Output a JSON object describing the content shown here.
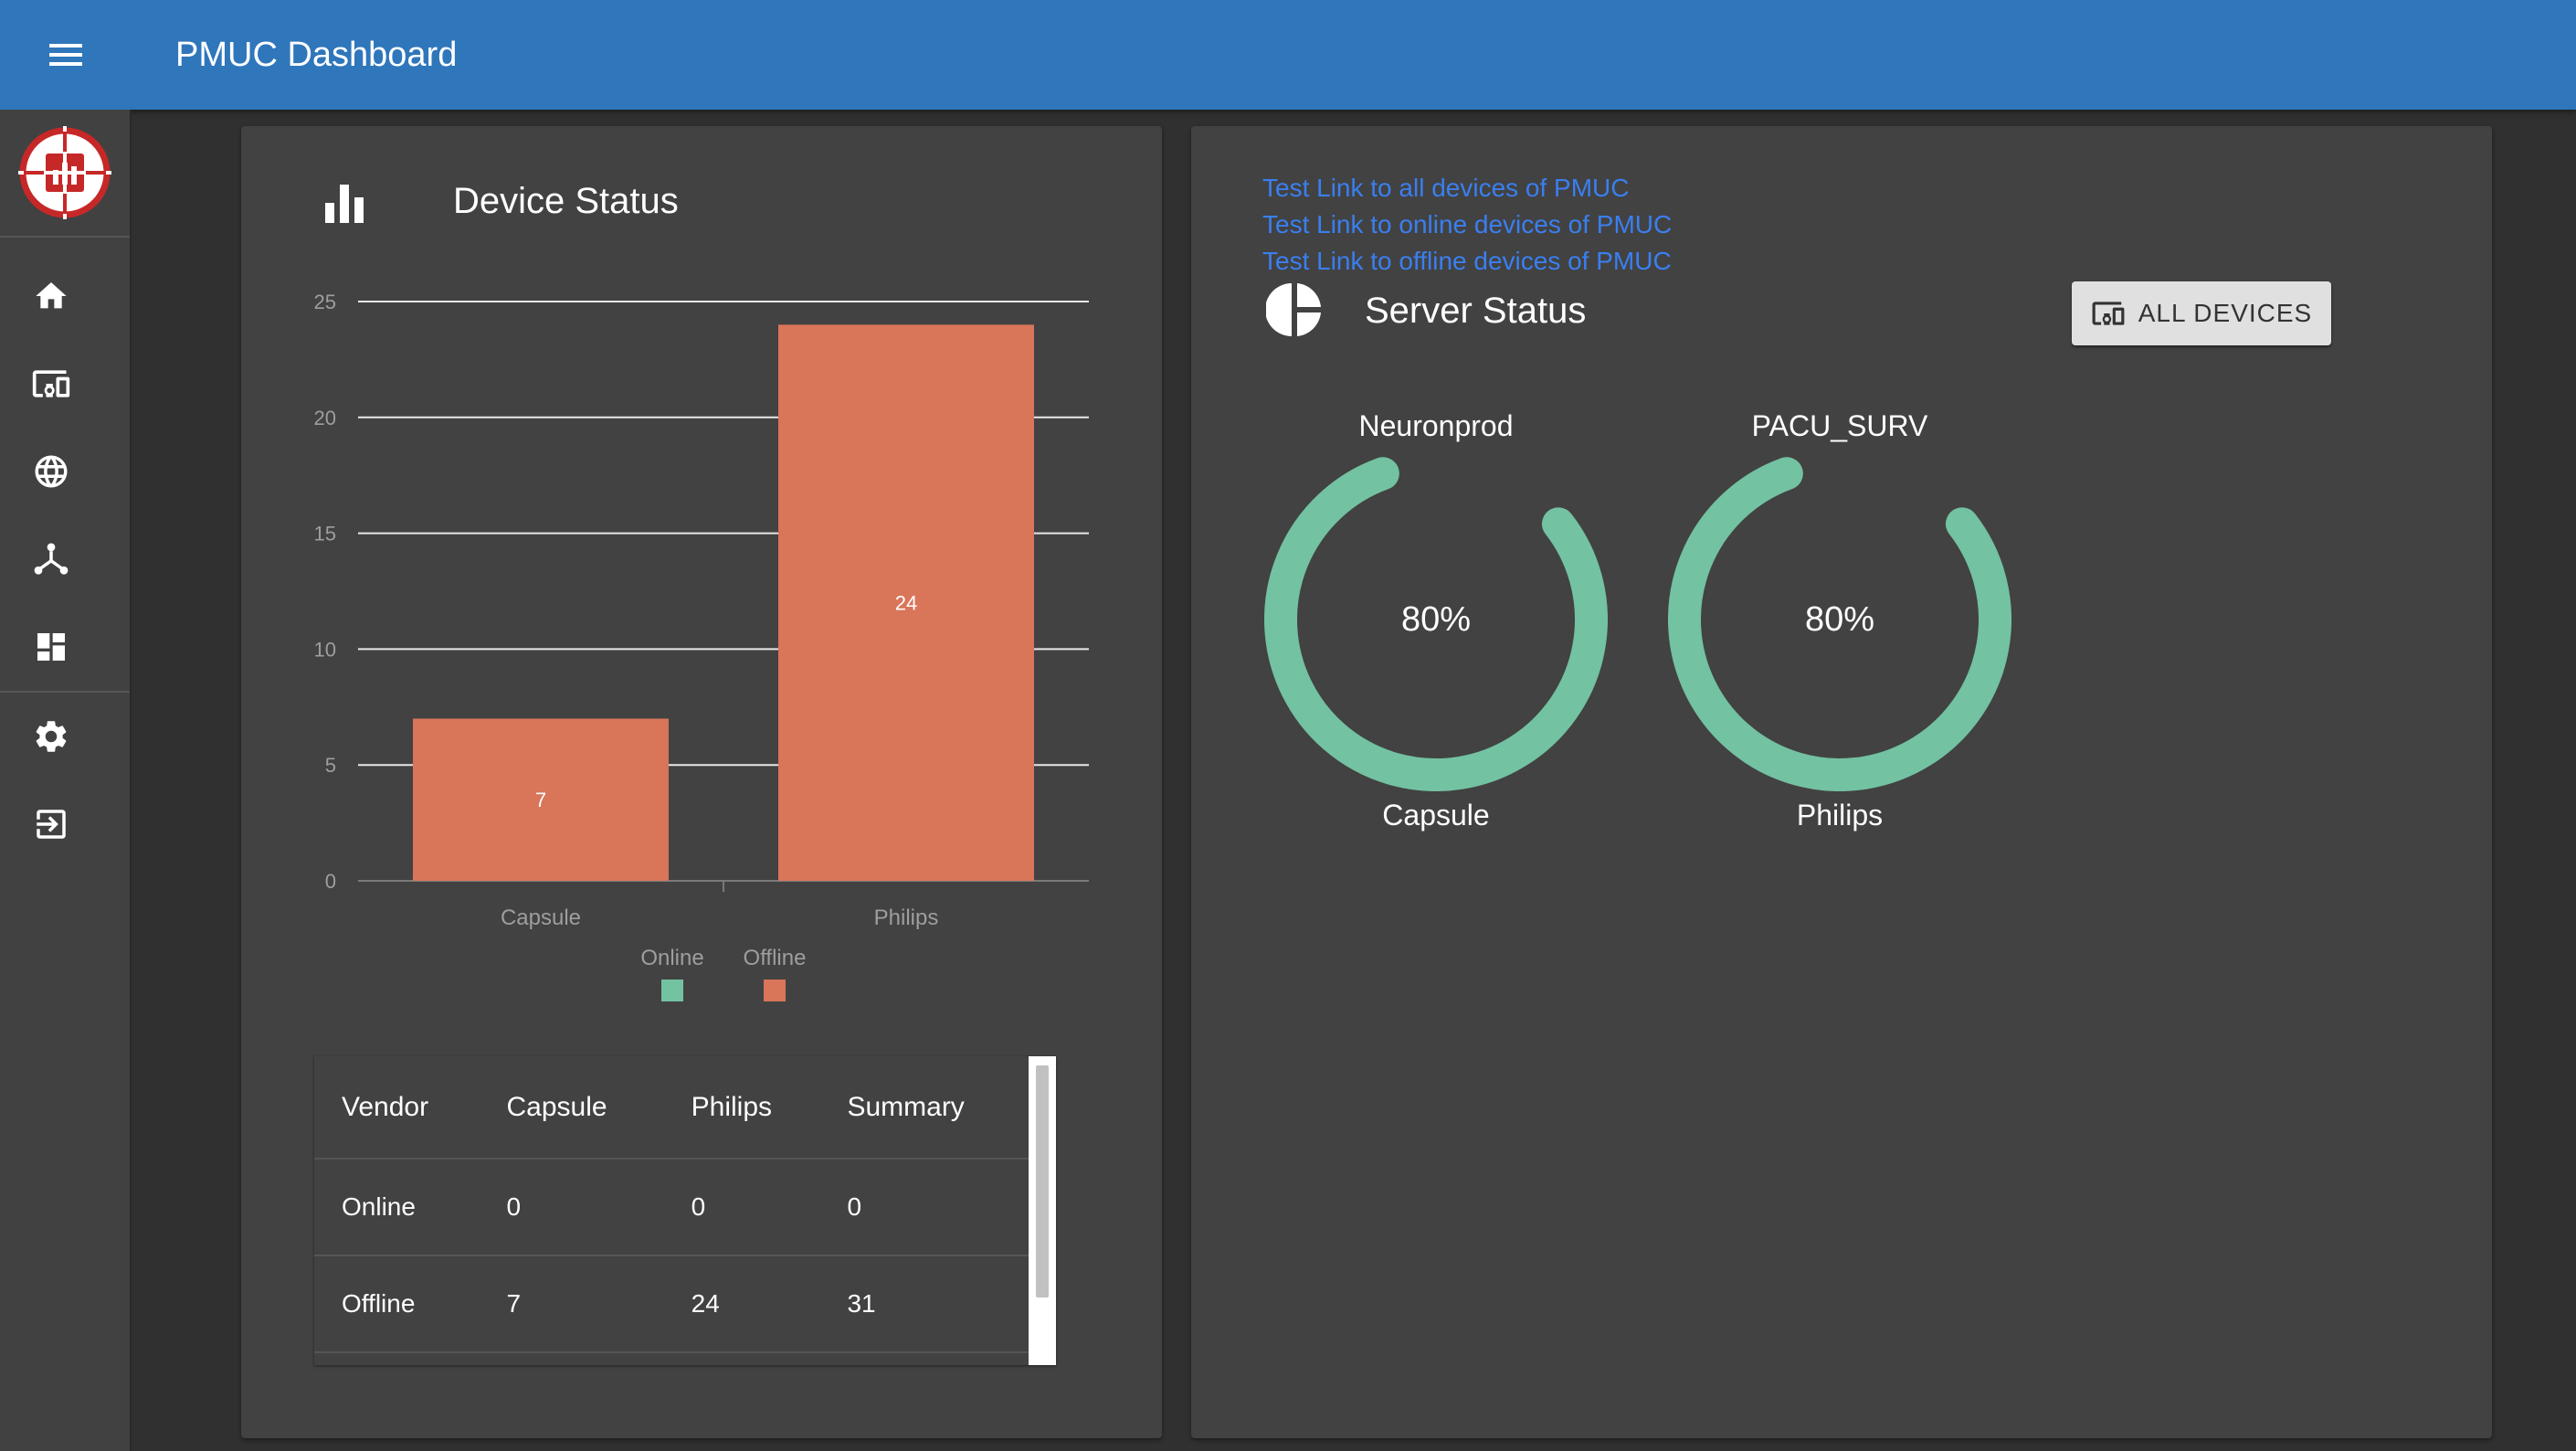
{
  "app": {
    "title": "PMUC Dashboard"
  },
  "icons": {
    "menu": "menu-icon",
    "logo": "pmuc-logo",
    "sidebar": [
      "home-icon",
      "devices-icon",
      "globe-icon",
      "hub-icon",
      "dashboard-icon",
      "settings-icon",
      "logout-icon"
    ],
    "device_status": "bar-chart-icon",
    "server_status": "pie-chart-icon",
    "all_devices_button": "devices-icon"
  },
  "colors": {
    "appbar": "#2f76bb",
    "background": "#303030",
    "card": "#424242",
    "sidebar": "#414141",
    "online": "#73c2a2",
    "offline": "#d97559",
    "link": "#3a7ff0",
    "gauge": "#73c2a2"
  },
  "device_status": {
    "title": "Device Status",
    "table": {
      "headers": [
        "Vendor",
        "Capsule",
        "Philips",
        "Summary"
      ],
      "rows": [
        [
          "Online",
          "0",
          "0",
          "0"
        ],
        [
          "Offline",
          "7",
          "24",
          "31"
        ]
      ]
    }
  },
  "chart_data": {
    "type": "bar",
    "categories": [
      "Capsule",
      "Philips"
    ],
    "series": [
      {
        "name": "Online",
        "values": [
          0,
          0
        ],
        "color": "#73c2a2"
      },
      {
        "name": "Offline",
        "values": [
          7,
          24
        ],
        "color": "#d97559"
      }
    ],
    "stacked": true,
    "data_labels": [
      "7",
      "24"
    ],
    "ylim": [
      0,
      25
    ],
    "yticks": [
      0,
      5,
      10,
      15,
      20,
      25
    ],
    "grid": true,
    "legend": "bottom"
  },
  "server_status": {
    "title": "Server Status",
    "links": [
      "Test Link to all devices of PMUC",
      "Test Link to online devices of PMUC",
      "Test Link to offline devices of PMUC"
    ],
    "all_devices_label": "ALL DEVICES",
    "gauges": [
      {
        "name": "Neuronprod",
        "vendor": "Capsule",
        "percent": 80,
        "label": "80%"
      },
      {
        "name": "PACU_SURV",
        "vendor": "Philips",
        "percent": 80,
        "label": "80%"
      }
    ]
  }
}
